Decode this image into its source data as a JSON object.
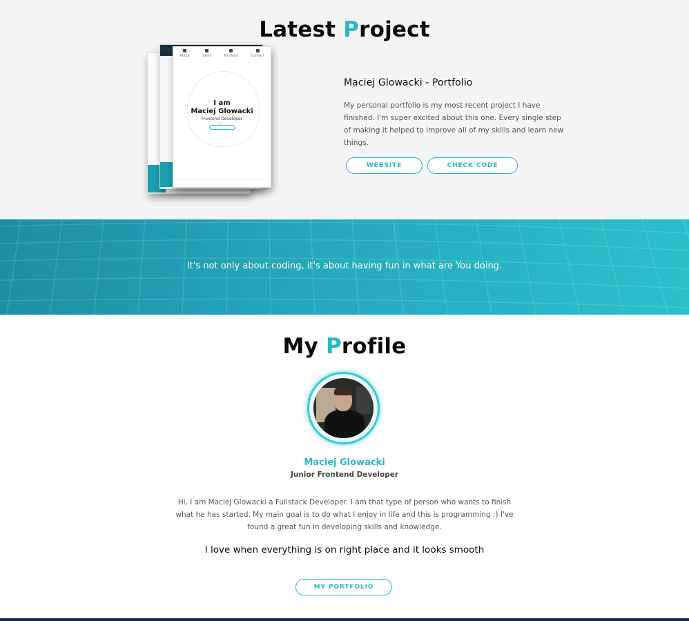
{
  "latest_project": {
    "title_first": "Latest ",
    "title_accent": "P",
    "title_rest": "roject",
    "mockup": {
      "nav": [
        "About",
        "Skills",
        "Portfolio",
        "Contact"
      ],
      "line1": "I am",
      "line2": "Maciej Glowacki",
      "line3": "Frontend Developer"
    },
    "name": "Maciej Glowacki - Portfolio",
    "description": "My personal portfolio is my most recent project I have finished. I'm super excited about this one. Every single step of making it helped to improve all of my skills and learn new things.",
    "buttons": {
      "website": "WEBSITE",
      "code": "CHECK CODE"
    }
  },
  "banner": {
    "text": "It's not only about coding, it's about having fun in what are You doing."
  },
  "profile": {
    "title_first": "My ",
    "title_accent": "P",
    "title_rest": "rofile",
    "name": "Maciej Glowacki",
    "role": "Junior Frontend Developer",
    "about": "Hi, I am Maciej Glowacki a Fullstack Developer. I am that type of person who wants to finish what he has started. My main goal is to do what I enjoy in life and this is programming :) I've found a great fun in developing skills and knowledge.",
    "tagline": "I love when everything is on right place and it looks smooth",
    "button": "MY PORTFOLIO"
  },
  "colors": {
    "accent": "#28b7c7",
    "banner": "#25a8bc",
    "dark": "#1c2f3c"
  }
}
